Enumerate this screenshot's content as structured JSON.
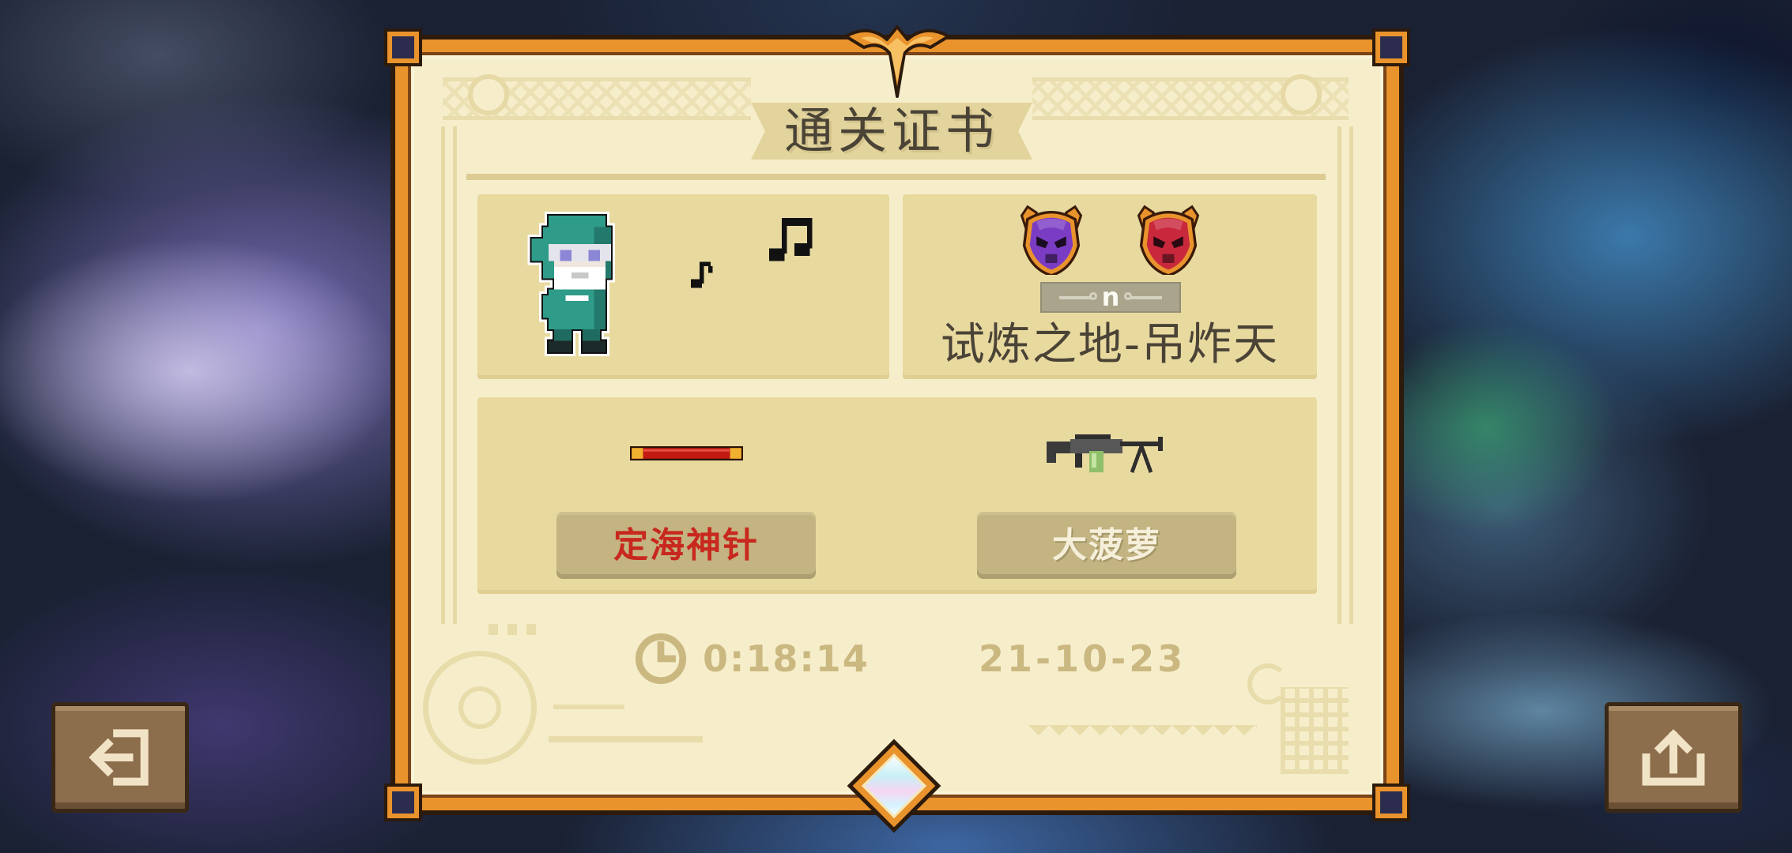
{
  "certificate": {
    "title": "通关证书",
    "character": {
      "icon": "character-sprite"
    },
    "mood_icons": [
      "music-note-icon",
      "music-notes-icon"
    ],
    "bosses": [
      {
        "icon": "demon-head-icon",
        "color": "#7b3cc4"
      },
      {
        "icon": "demon-head-icon",
        "color": "#c9283c"
      }
    ],
    "difficulty_badge": "n",
    "stage_name": "试炼之地-吊炸天",
    "weapons": [
      {
        "icon": "staff-weapon-icon",
        "name": "定海神针",
        "name_color": "#c8281e"
      },
      {
        "icon": "machine-gun-icon",
        "name": "大菠萝",
        "name_color": "#f5efda"
      }
    ],
    "time_icon": "clock-icon",
    "clear_time": "0:18:14",
    "date": "21-10-23"
  },
  "buttons": {
    "exit": {
      "icon": "exit-icon"
    },
    "share": {
      "icon": "share-icon"
    }
  },
  "theme": {
    "frame": "#e9932d",
    "parchment": "#f6eecb",
    "panel": "#e8d99f",
    "label": "#c3b482",
    "text_dark": "#4a4336",
    "text_muted": "#cbb880",
    "button": "#8c6d4c"
  }
}
